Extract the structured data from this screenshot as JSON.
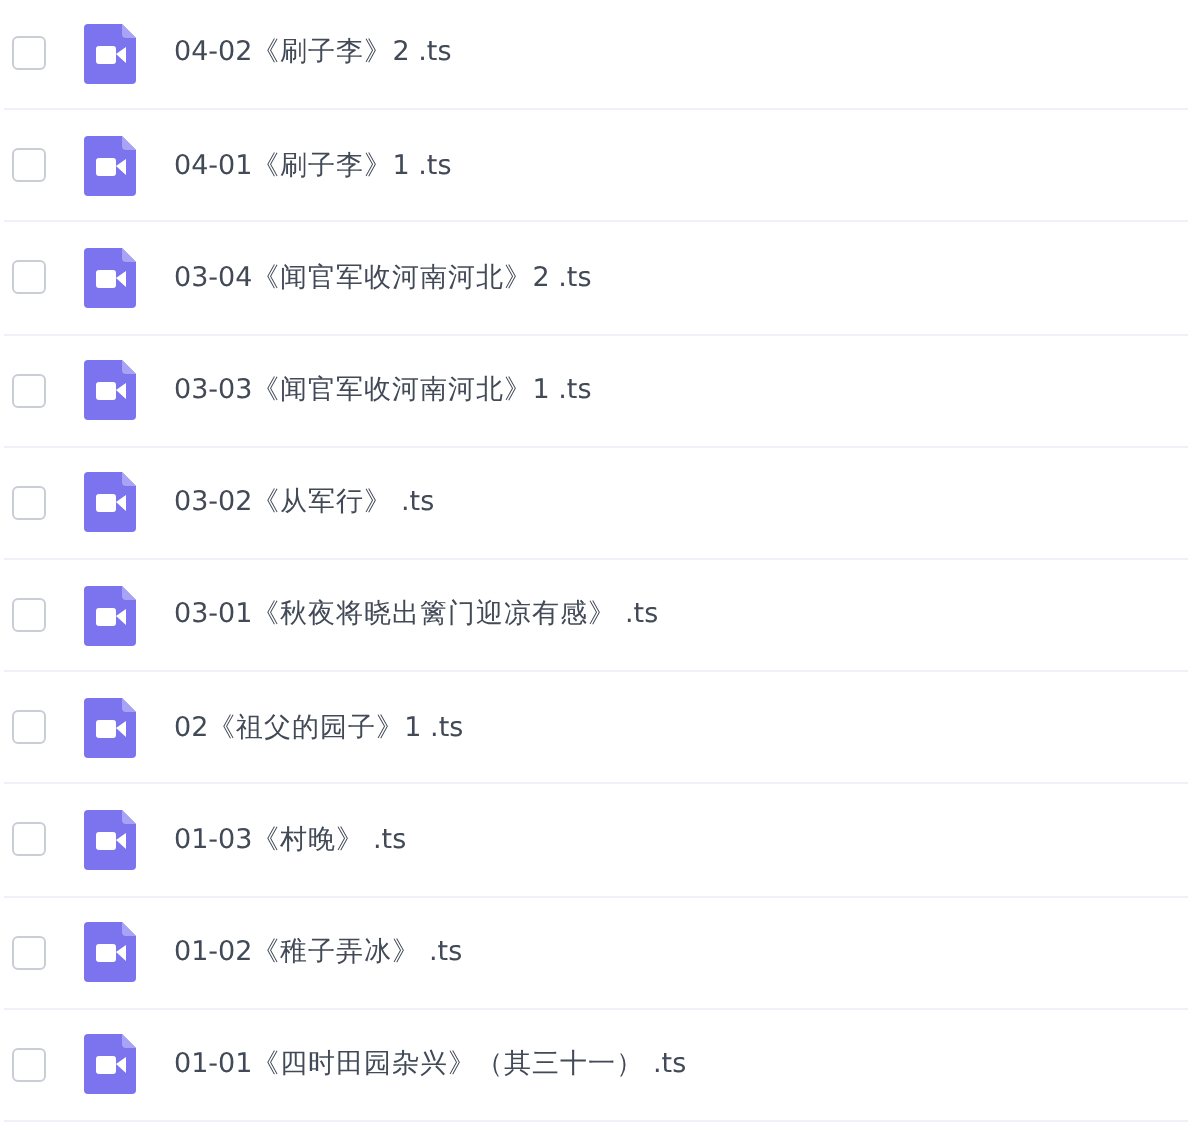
{
  "files": [
    {
      "name": "04-02《刷子李》2 .ts",
      "checked": false
    },
    {
      "name": "04-01《刷子李》1 .ts",
      "checked": false
    },
    {
      "name": "03-04《闻官军收河南河北》2 .ts",
      "checked": false
    },
    {
      "name": "03-03《闻官军收河南河北》1 .ts",
      "checked": false
    },
    {
      "name": "03-02《从军行》 .ts",
      "checked": false
    },
    {
      "name": "03-01《秋夜将晓出篱门迎凉有感》 .ts",
      "checked": false
    },
    {
      "name": "02《祖父的园子》1 .ts",
      "checked": false
    },
    {
      "name": "01-03《村晚》 .ts",
      "checked": false
    },
    {
      "name": "01-02《稚子弄冰》 .ts",
      "checked": false
    },
    {
      "name": "01-01《四时田园杂兴》（其三十一） .ts",
      "checked": false
    }
  ]
}
